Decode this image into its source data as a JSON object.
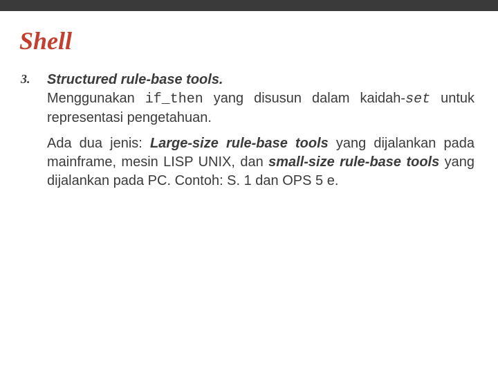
{
  "title": "Shell",
  "list": {
    "marker": "3.",
    "heading": "Structured rule-base tools.",
    "p1_a": "Menggunakan ",
    "p1_code1": "if_then",
    "p1_b": " yang disusun dalam kaidah-",
    "p1_code2": "set",
    "p1_c": " untuk representasi pengetahuan.",
    "p2_a": "Ada dua jenis: ",
    "p2_em1": "Large-size rule-base tools",
    "p2_b": " yang dijalankan pada mainframe, mesin LISP UNIX, dan ",
    "p2_em2": "small-size rule-base tools",
    "p2_c": " yang dijalankan pada PC. Contoh: S. 1 dan OPS 5 e."
  }
}
